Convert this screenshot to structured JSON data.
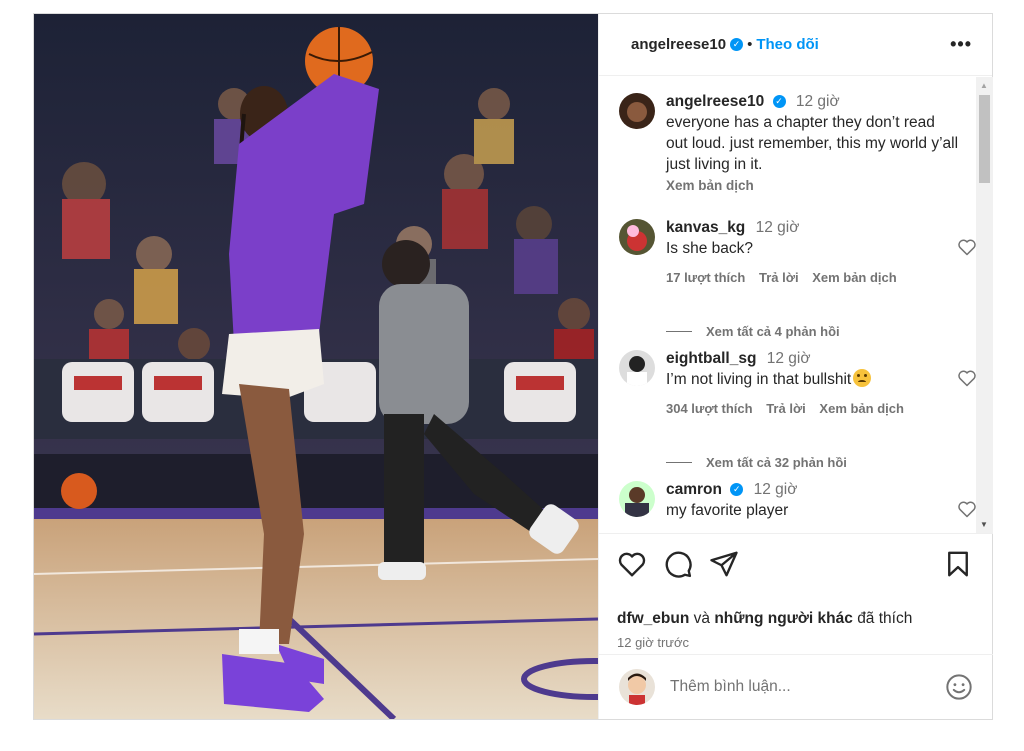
{
  "post": {
    "author": "angelreese10",
    "dot": "•",
    "follow_label": "Theo dõi",
    "more_label": "•••"
  },
  "caption": {
    "user": "angelreese10",
    "time": "12 giờ",
    "text": "everyone has a chapter they don’t read out loud. just remember, this my world y’all just living in it.",
    "translate": "Xem bản dịch"
  },
  "comments": [
    {
      "user": "kanvas_kg",
      "time": "12 giờ",
      "text": "Is she back?",
      "likes": "17 lượt thích",
      "reply": "Trả lời",
      "translate": "Xem bản dịch",
      "view_replies": "Xem tất cả 4 phản hồi"
    },
    {
      "user": "eightball_sg",
      "time": "12 giờ",
      "text": "I’m not living in that bullshit",
      "likes": "304 lượt thích",
      "reply": "Trả lời",
      "translate": "Xem bản dịch",
      "view_replies": "Xem tất cả 32 phản hồi"
    },
    {
      "user": "camron",
      "time": "12 giờ",
      "text": "my favorite player"
    }
  ],
  "likes_line": {
    "user": "dfw_ebun",
    "connector": "và",
    "others": "những người khác",
    "suffix": "đã thích"
  },
  "posted_ago": "12 giờ trước",
  "add_comment_placeholder": "Thêm bình luận...",
  "colors": {
    "accent": "#0095f6",
    "muted": "#737373",
    "jersey": "#7b3fc9"
  }
}
